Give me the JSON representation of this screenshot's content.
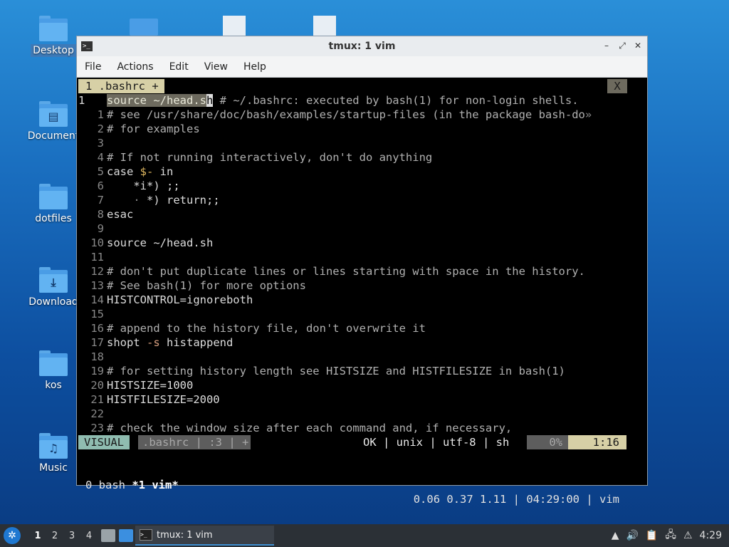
{
  "desktop": {
    "icons": [
      {
        "label": "Desktop"
      },
      {
        "label": "Document"
      },
      {
        "label": "dotfiles"
      },
      {
        "label": "Download"
      },
      {
        "label": "kos"
      },
      {
        "label": "Music"
      }
    ]
  },
  "window": {
    "title": "tmux: 1 vim",
    "menu": [
      "File",
      "Actions",
      "Edit",
      "View",
      "Help"
    ]
  },
  "vim": {
    "tab_label": "1 .bashrc +",
    "close_label": "X",
    "status": {
      "mode": "VISUAL",
      "file": ".bashrc | :3 | +",
      "info": "OK | unix | utf-8 | sh",
      "percent": "0%",
      "position": "1:16"
    }
  },
  "tmux": {
    "left_prefix": "0 bash ",
    "active_window": "*1 vim*",
    "right": "0.06 0.37 1.11 | 04:29:00 | vim"
  },
  "taskbar": {
    "workspaces": [
      "1",
      "2",
      "3",
      "4"
    ],
    "task_label": "tmux: 1 vim",
    "clock": "4:29"
  }
}
